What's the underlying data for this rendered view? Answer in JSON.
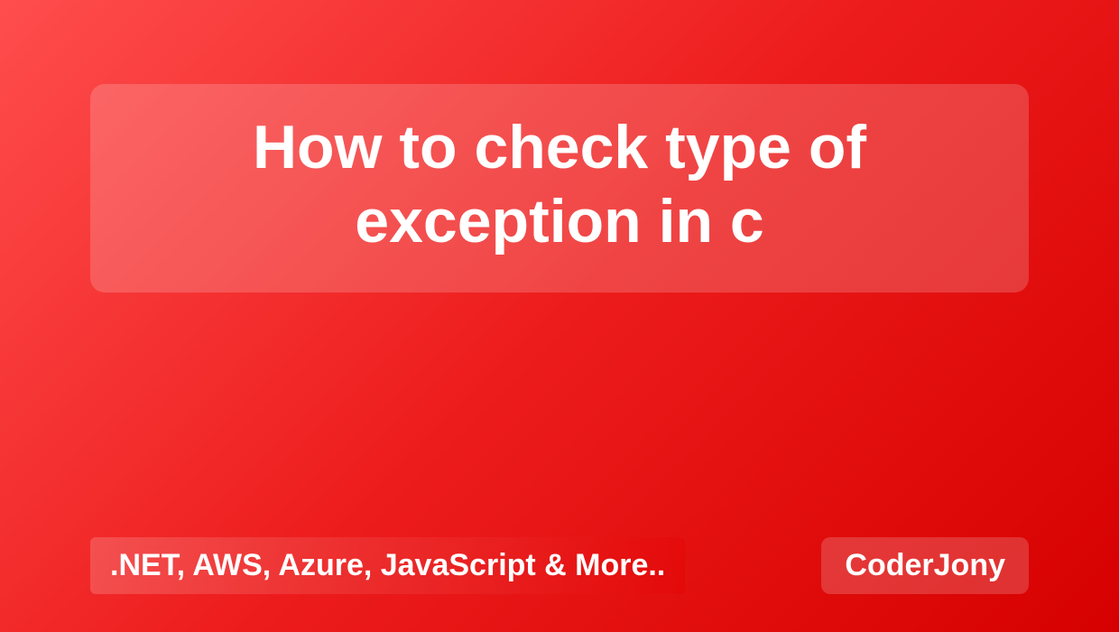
{
  "title": "How to check type of exception in c",
  "tagline": ".NET, AWS, Azure, JavaScript & More..",
  "brand": "CoderJony"
}
